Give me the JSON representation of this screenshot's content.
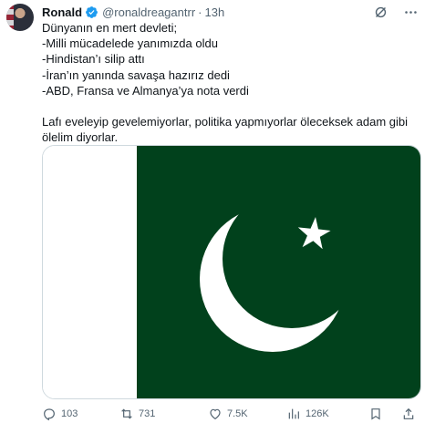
{
  "tweet": {
    "author_name": "Ronald",
    "handle": "@ronaldreagantrr",
    "separator": "·",
    "time": "13h",
    "lines": [
      "Dünyanın en mert devleti;",
      "-Milli mücadelede yanımızda oldu",
      "-Hindistan’ı silip attı",
      "-İran’ın yanında savaşa hazırız dedi",
      "-ABD, Fransa ve Almanya’ya nota verdi"
    ],
    "paragraph2_line1": "Lafı eveleyip gevelemiyorlar, politika yapmıyorlar öleceksek adam gibi",
    "paragraph2_line2": "ölelim diyorlar."
  },
  "media": {
    "description_icon": "pakistan-flag",
    "green": "#01411c",
    "white": "#ffffff"
  },
  "actions": {
    "replies": "103",
    "reposts": "731",
    "likes": "7.5K",
    "views": "126K"
  },
  "colors": {
    "text": "#0f1419",
    "muted": "#536471",
    "verified": "#1d9bf0",
    "border": "#cfd9de"
  }
}
